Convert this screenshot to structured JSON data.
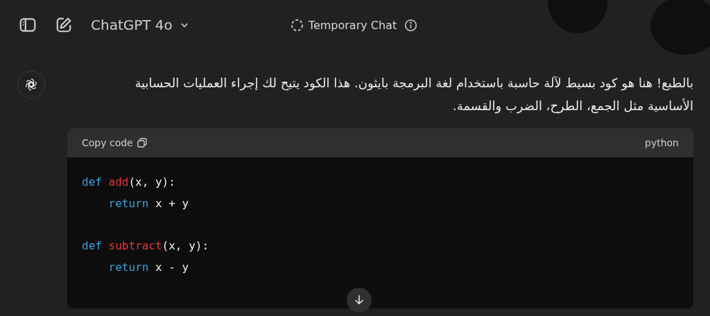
{
  "header": {
    "model": "ChatGPT 4o",
    "temporary_chat": "Temporary Chat"
  },
  "message": {
    "text": "بالطبع! هنا هو كود بسيط لآلة حاسبة باستخدام لغة البرمجة بايثون. هذا الكود يتيح لك إجراء العمليات الحسابية الأساسية مثل الجمع، الطرح، الضرب والقسمة."
  },
  "code_block": {
    "copy_label": "Copy code",
    "language": "python",
    "lines": [
      {
        "kind": "code",
        "tokens": [
          {
            "kind": "keyword",
            "text": "def"
          },
          {
            "kind": "function",
            "text": "add"
          },
          {
            "kind": "plain",
            "text": "(x, y):"
          }
        ]
      },
      {
        "kind": "indented",
        "tokens": [
          {
            "kind": "keyword",
            "text": "return"
          },
          {
            "kind": "plain",
            "text": " x + y"
          }
        ]
      },
      {
        "kind": "blank"
      },
      {
        "kind": "code",
        "tokens": [
          {
            "kind": "keyword",
            "text": "def"
          },
          {
            "kind": "function",
            "text": "subtract"
          },
          {
            "kind": "plain",
            "text": "(x, y):"
          }
        ]
      },
      {
        "kind": "indented",
        "tokens": [
          {
            "kind": "keyword",
            "text": "return"
          },
          {
            "kind": "plain",
            "text": " x - y"
          }
        ]
      }
    ]
  }
}
